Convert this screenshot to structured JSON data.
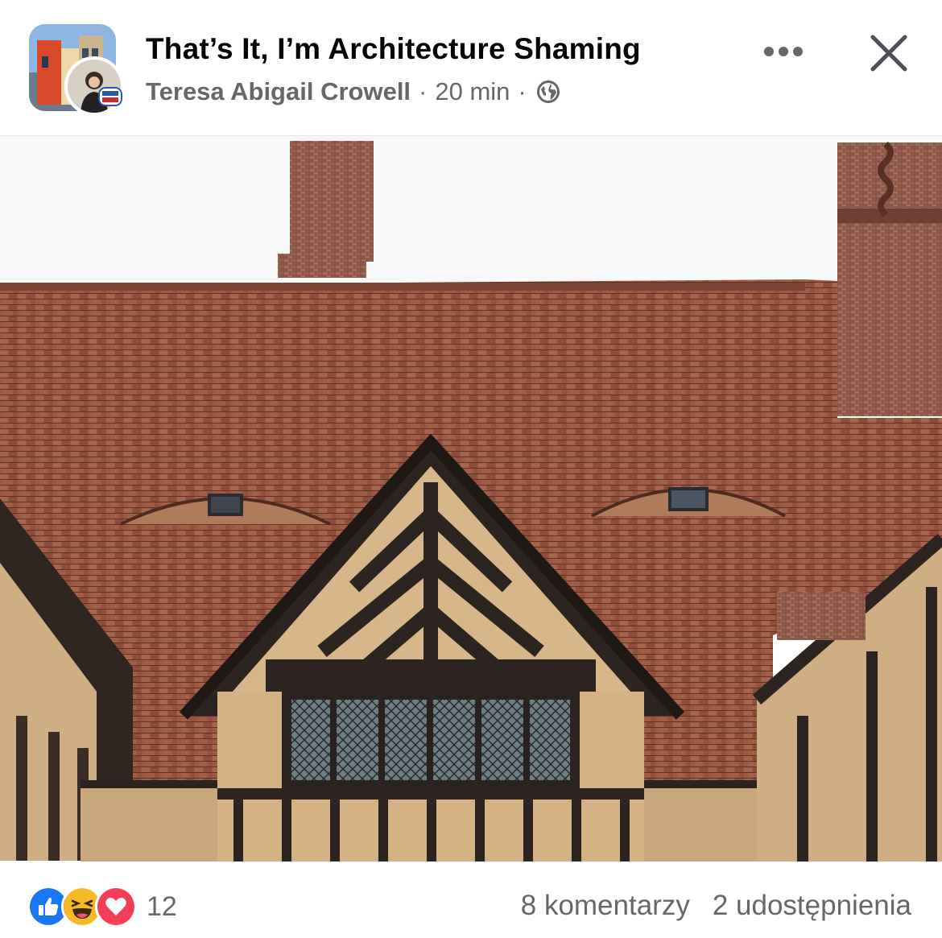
{
  "post": {
    "group_name": "That’s It, I’m Architecture Shaming",
    "author": "Teresa Abigail Crowell",
    "separator": "·",
    "time": "20 min",
    "privacy_icon": "globe-icon"
  },
  "header": {
    "more_icon": "more-horizontal-icon",
    "close_icon": "close-icon"
  },
  "photo": {
    "subject": "tudor-house-roof-with-eye-shaped-dormers"
  },
  "footer": {
    "reaction_icons": [
      "like-icon",
      "haha-icon",
      "love-icon"
    ],
    "reaction_count": "12",
    "comments": "8 komentarzy",
    "shares": "2 udostępnienia"
  },
  "colors": {
    "like_blue": "#1877f2",
    "love_red": "#f33e58",
    "haha_yellow": "#f7b928",
    "secondary_text": "#65676b",
    "primary_text": "#050505"
  }
}
